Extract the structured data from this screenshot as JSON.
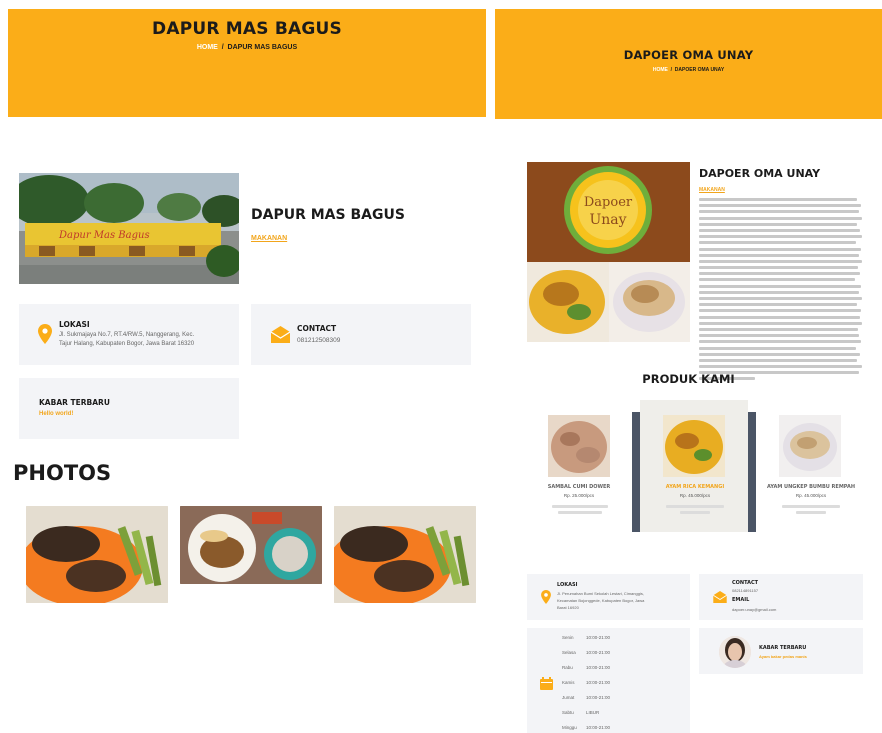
{
  "left": {
    "hero": {
      "title": "DAPUR MAS BAGUS",
      "breadcrumb_home": "HOME",
      "breadcrumb_sep": "/",
      "breadcrumb_current": "DAPUR MAS BAGUS"
    },
    "shop_name": "DAPUR MAS BAGUS",
    "category": "MAKANAN",
    "lokasi": {
      "title": "LOKASI",
      "address_line1": "Jl. Sukmajaya No.7, RT.4/RW.5, Nanggerang, Kec.",
      "address_line2": "Tajur Halang, Kabupaten Bogor, Jawa Barat 16320"
    },
    "contact": {
      "title": "CONTACT",
      "phone": "081212508309"
    },
    "kabar": {
      "title": "KABAR TERBARU",
      "text": "Hello world!"
    },
    "photos_title": "PHOTOS",
    "store_sign": "Dapur Mas Bagus"
  },
  "right": {
    "hero": {
      "title": "DAPOER OMA UNAY",
      "breadcrumb_home": "HOME",
      "breadcrumb_sep": "/",
      "breadcrumb_current": "DAPOER OMA UNAY"
    },
    "logo_line1": "Dapoer",
    "logo_line2": "Unay",
    "shop_name": "DAPOER OMA UNAY",
    "category": "MAKANAN",
    "produk_title": "PRODUK KAMI",
    "products": [
      {
        "name": "SAMBAL CUMI DOWER",
        "price": "Rp. 25.000/pcs"
      },
      {
        "name": "AYAM RICA KEMANGI",
        "price": "Rp. 45.000/pcs"
      },
      {
        "name": "AYAM UNGKEP BUMBU REMPAH",
        "price": "Rp. 45.000/pcs"
      }
    ],
    "lokasi": {
      "title": "LOKASI",
      "address_line1": "Jl. Perumahan Bumi Sekolah Lestari, Cimanggis,",
      "address_line2": "Kecamatan Bojonggede, Kabupaten Bogor, Jawa",
      "address_line3": "Barat 16920"
    },
    "contact": {
      "title": "CONTACT",
      "phone": "082114891157",
      "email_title": "EMAIL",
      "email": "dapoer.unay@gmail.com"
    },
    "hours": [
      {
        "day": "Senin",
        "time": "10:00-21:00"
      },
      {
        "day": "Selasa",
        "time": "10:00-21:00"
      },
      {
        "day": "Rabu",
        "time": "10:00-21:00"
      },
      {
        "day": "Kamis",
        "time": "10:00-21:00"
      },
      {
        "day": "Jumat",
        "time": "10:00-21:00"
      },
      {
        "day": "Sabtu",
        "time": "LIBUR"
      },
      {
        "day": "Minggu",
        "time": "10:00-21:00"
      }
    ],
    "kabar": {
      "title": "KABAR TERBARU",
      "text": "Ayam bakar pedas manis"
    }
  },
  "colors": {
    "accent": "#fbad18",
    "card": "#f3f4f7",
    "dark": "#1b1b1b"
  }
}
